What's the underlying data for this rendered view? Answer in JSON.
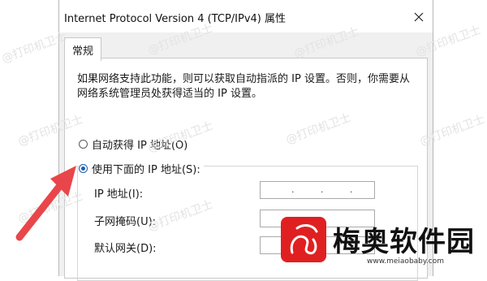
{
  "window": {
    "title": "Internet Protocol Version 4 (TCP/IPv4) 属性"
  },
  "tabs": [
    {
      "label": "常规"
    }
  ],
  "general": {
    "description": "如果网络支持此功能，则可以获取自动指派的 IP 设置。否则，你需要从网络系统管理员处获得适当的 IP 设置。",
    "auto_ip_label": "自动获得 IP 地址(O)",
    "manual_ip_label": "使用下面的 IP 地址(S):",
    "selected": "manual",
    "fields": [
      {
        "label": "IP 地址(I):",
        "value": ""
      },
      {
        "label": "子网掩码(U):",
        "value": ""
      },
      {
        "label": "默认网关(D):",
        "value": ""
      }
    ]
  },
  "overlay": {
    "watermark": "@打印机卫士",
    "logo_name": "梅奥软件园",
    "logo_url": "www.meiaobaby.com",
    "accent_color": "#e02020"
  }
}
